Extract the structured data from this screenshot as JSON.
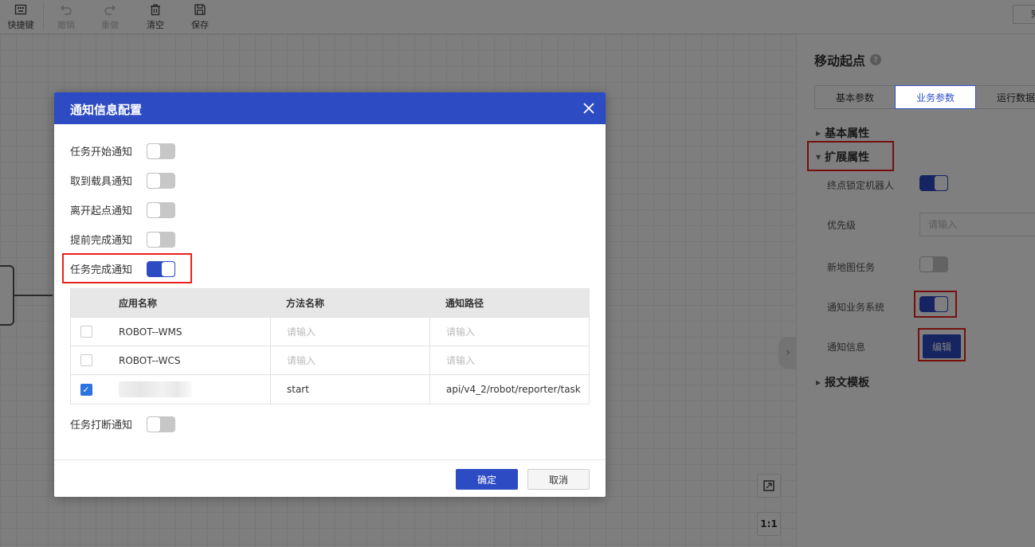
{
  "toolbar": {
    "shortcut": "快捷键",
    "undo": "撤销",
    "redo": "重做",
    "clear": "清空",
    "save": "保存"
  },
  "canvas": {
    "fit_button": "⛶",
    "ratio_button": "1:1"
  },
  "panel": {
    "title": "移动起点",
    "tabs": [
      "基本参数",
      "业务参数",
      "运行数据"
    ],
    "sections": {
      "basic": "基本属性",
      "extended": "扩展属性",
      "template": "报文模板"
    },
    "props": {
      "lock_robot": "终点锁定机器人",
      "priority": "优先级",
      "priority_placeholder": "请输入",
      "new_map_task": "新地图任务",
      "notify_system": "通知业务系统",
      "notify_info": "通知信息",
      "edit_button": "编辑"
    },
    "switch_states": {
      "lock_robot": true,
      "new_map_task": false,
      "notify_system": true
    }
  },
  "modal": {
    "title": "通知信息配置",
    "toggles": [
      {
        "label": "任务开始通知",
        "on": false
      },
      {
        "label": "取到载具通知",
        "on": false
      },
      {
        "label": "离开起点通知",
        "on": false
      },
      {
        "label": "提前完成通知",
        "on": false
      },
      {
        "label": "任务完成通知",
        "on": true
      }
    ],
    "interrupt_toggle": {
      "label": "任务打断通知",
      "on": false
    },
    "table": {
      "headers": [
        "应用名称",
        "方法名称",
        "通知路径"
      ],
      "placeholder": "请输入",
      "rows": [
        {
          "checked": false,
          "app": "ROBOT--WMS",
          "method": "",
          "path": ""
        },
        {
          "checked": false,
          "app": "ROBOT--WCS",
          "method": "",
          "path": ""
        },
        {
          "checked": true,
          "app": "",
          "method": "start",
          "path": "api/v4_2/robot/reporter/task"
        }
      ]
    },
    "confirm": "确定",
    "cancel": "取消"
  },
  "colors": {
    "primary": "#2d4bc3",
    "highlight": "#e8221c"
  }
}
